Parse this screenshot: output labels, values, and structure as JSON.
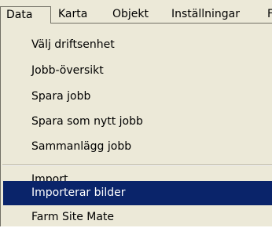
{
  "menubar": {
    "items": [
      {
        "label": "Data"
      },
      {
        "label": "Karta"
      },
      {
        "label": "Objekt"
      },
      {
        "label": "Inställningar"
      },
      {
        "label": "F"
      }
    ]
  },
  "dropdown": {
    "items": [
      {
        "label": "Välj driftsenhet"
      },
      {
        "label": "Jobb-översikt"
      },
      {
        "label": "Spara jobb"
      },
      {
        "label": "Spara som nytt jobb"
      },
      {
        "label": "Sammanlägg jobb"
      },
      {
        "label": "Import"
      },
      {
        "label": "Importerar bilder",
        "highlighted": true
      },
      {
        "label": "Farm Site Mate"
      }
    ]
  },
  "colors": {
    "menu_background": "#ece9d8",
    "highlight_background": "#0a246a",
    "highlight_text": "#ffffff",
    "border": "#716f64"
  }
}
